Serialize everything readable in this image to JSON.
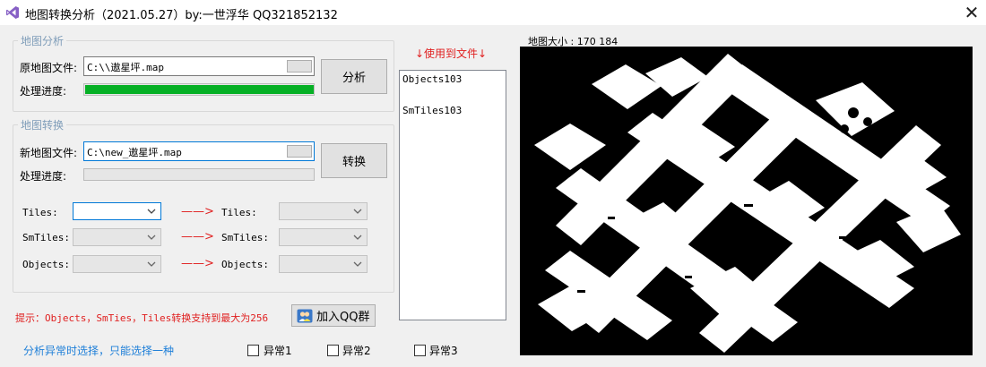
{
  "window": {
    "title": "地图转换分析（2021.05.27）by:一世浮华 QQ321852132",
    "close": "✕"
  },
  "analysis": {
    "group_title": "地图分析",
    "file_label": "原地图文件:",
    "file_value": "C:\\\\遨星坪.map",
    "progress_label": "处理进度:",
    "progress": 1.0,
    "button": "分析"
  },
  "convert": {
    "group_title": "地图转换",
    "file_label": "新地图文件:",
    "file_value": "C:\\new_遨星坪.map",
    "progress_label": "处理进度:",
    "progress": 0.0,
    "button": "转换"
  },
  "mapping": {
    "arrow": "——>",
    "rows": [
      {
        "left_label": "Tiles:",
        "right_label": "Tiles:"
      },
      {
        "left_label": "SmTiles:",
        "right_label": "SmTiles:"
      },
      {
        "left_label": "Objects:",
        "right_label": "Objects:"
      }
    ]
  },
  "hint": "提示：Objects，SmTies，Tiles转换支持到最大为256",
  "qq_button": "加入QQ群",
  "anomaly": {
    "hint": "分析异常时选择，只能选择一种",
    "options": [
      "异常1",
      "异常2",
      "异常3"
    ]
  },
  "files_panel": {
    "title": "↓使用到文件↓",
    "items": [
      "Objects103",
      "SmTiles103"
    ]
  },
  "map": {
    "label": "地图大小 : 170  184"
  },
  "colors": {
    "accent": "#0078d7",
    "progress": "#06b025",
    "warn": "#e02020",
    "group_title": "#7f9db9"
  }
}
